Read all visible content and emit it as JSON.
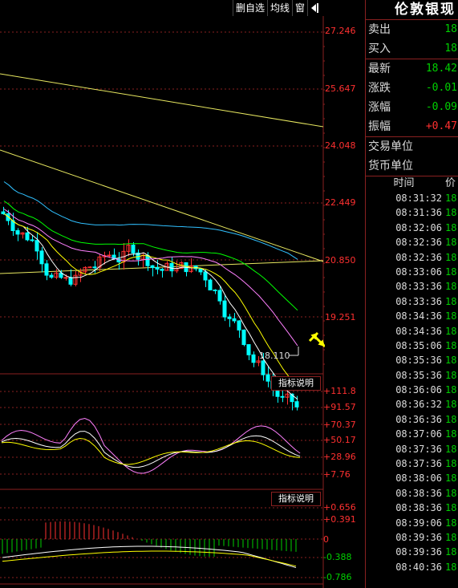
{
  "toolbar": {
    "delete_watch": "删自选",
    "ma_line": "均线",
    "window": "窗"
  },
  "main_pane": {
    "price_ticks": [
      "27.246",
      "25.647",
      "24.048",
      "22.449",
      "20.850",
      "19.251"
    ],
    "tick_values": [
      27.246,
      25.647,
      24.048,
      22.449,
      20.85,
      19.251
    ],
    "low_annotation": "18.110"
  },
  "indicator_pane_1": {
    "title": "指标说明",
    "ticks": [
      "+111.8",
      "+91.57",
      "+70.37",
      "+50.17",
      "+28.96",
      "+7.76"
    ]
  },
  "indicator_pane_2": {
    "title": "指标说明",
    "ticks": [
      "+0.656",
      "+0.391",
      "0",
      "-0.388",
      "-0.786"
    ]
  },
  "quote": {
    "title": "伦敦银现",
    "rows": [
      {
        "label": "卖出",
        "value": "18",
        "color": "#00d000"
      },
      {
        "label": "买入",
        "value": "18",
        "color": "#00d000"
      },
      {
        "label": "最新",
        "value": "18.42",
        "color": "#00d000"
      },
      {
        "label": "涨跌",
        "value": "-0.01",
        "color": "#00d000"
      },
      {
        "label": "涨幅",
        "value": "-0.09",
        "color": "#00d000"
      },
      {
        "label": "振幅",
        "value": "+0.47",
        "color": "#ff3030"
      },
      {
        "label": "交易单位",
        "value": "",
        "color": "#ddd"
      },
      {
        "label": "货币单位",
        "value": "",
        "color": "#ddd"
      }
    ],
    "ticks_header": {
      "time": "时间",
      "price": "价"
    },
    "ticks": [
      {
        "time": "08:31:32",
        "price": "18."
      },
      {
        "time": "08:31:36",
        "price": "18."
      },
      {
        "time": "08:32:06",
        "price": "18."
      },
      {
        "time": "08:32:36",
        "price": "18."
      },
      {
        "time": "08:32:36",
        "price": "18."
      },
      {
        "time": "08:33:06",
        "price": "18."
      },
      {
        "time": "08:33:36",
        "price": "18."
      },
      {
        "time": "08:33:36",
        "price": "18."
      },
      {
        "time": "08:34:36",
        "price": "18."
      },
      {
        "time": "08:34:36",
        "price": "18."
      },
      {
        "time": "08:35:06",
        "price": "18."
      },
      {
        "time": "08:35:36",
        "price": "18."
      },
      {
        "time": "08:35:36",
        "price": "18."
      },
      {
        "time": "08:36:06",
        "price": "18."
      },
      {
        "time": "08:36:32",
        "price": "18."
      },
      {
        "time": "08:36:36",
        "price": "18."
      },
      {
        "time": "08:37:06",
        "price": "18."
      },
      {
        "time": "08:37:36",
        "price": "18."
      },
      {
        "time": "08:37:36",
        "price": "18."
      },
      {
        "time": "08:38:06",
        "price": "18."
      },
      {
        "time": "08:38:36",
        "price": "18."
      },
      {
        "time": "08:38:36",
        "price": "18."
      },
      {
        "time": "08:39:06",
        "price": "18."
      },
      {
        "time": "08:39:36",
        "price": "18."
      },
      {
        "time": "08:39:36",
        "price": "18."
      },
      {
        "time": "08:40:36",
        "price": "18."
      }
    ]
  },
  "colors": {
    "up": "#ff3030",
    "down": "#00ffff",
    "grid": "#8a2020",
    "ma5": "#ffffff",
    "ma10": "#ffff00",
    "ma20": "#ff80ff",
    "ma30": "#00ff00",
    "ma60": "#30c0ff",
    "trendline": "#e8e860"
  }
}
